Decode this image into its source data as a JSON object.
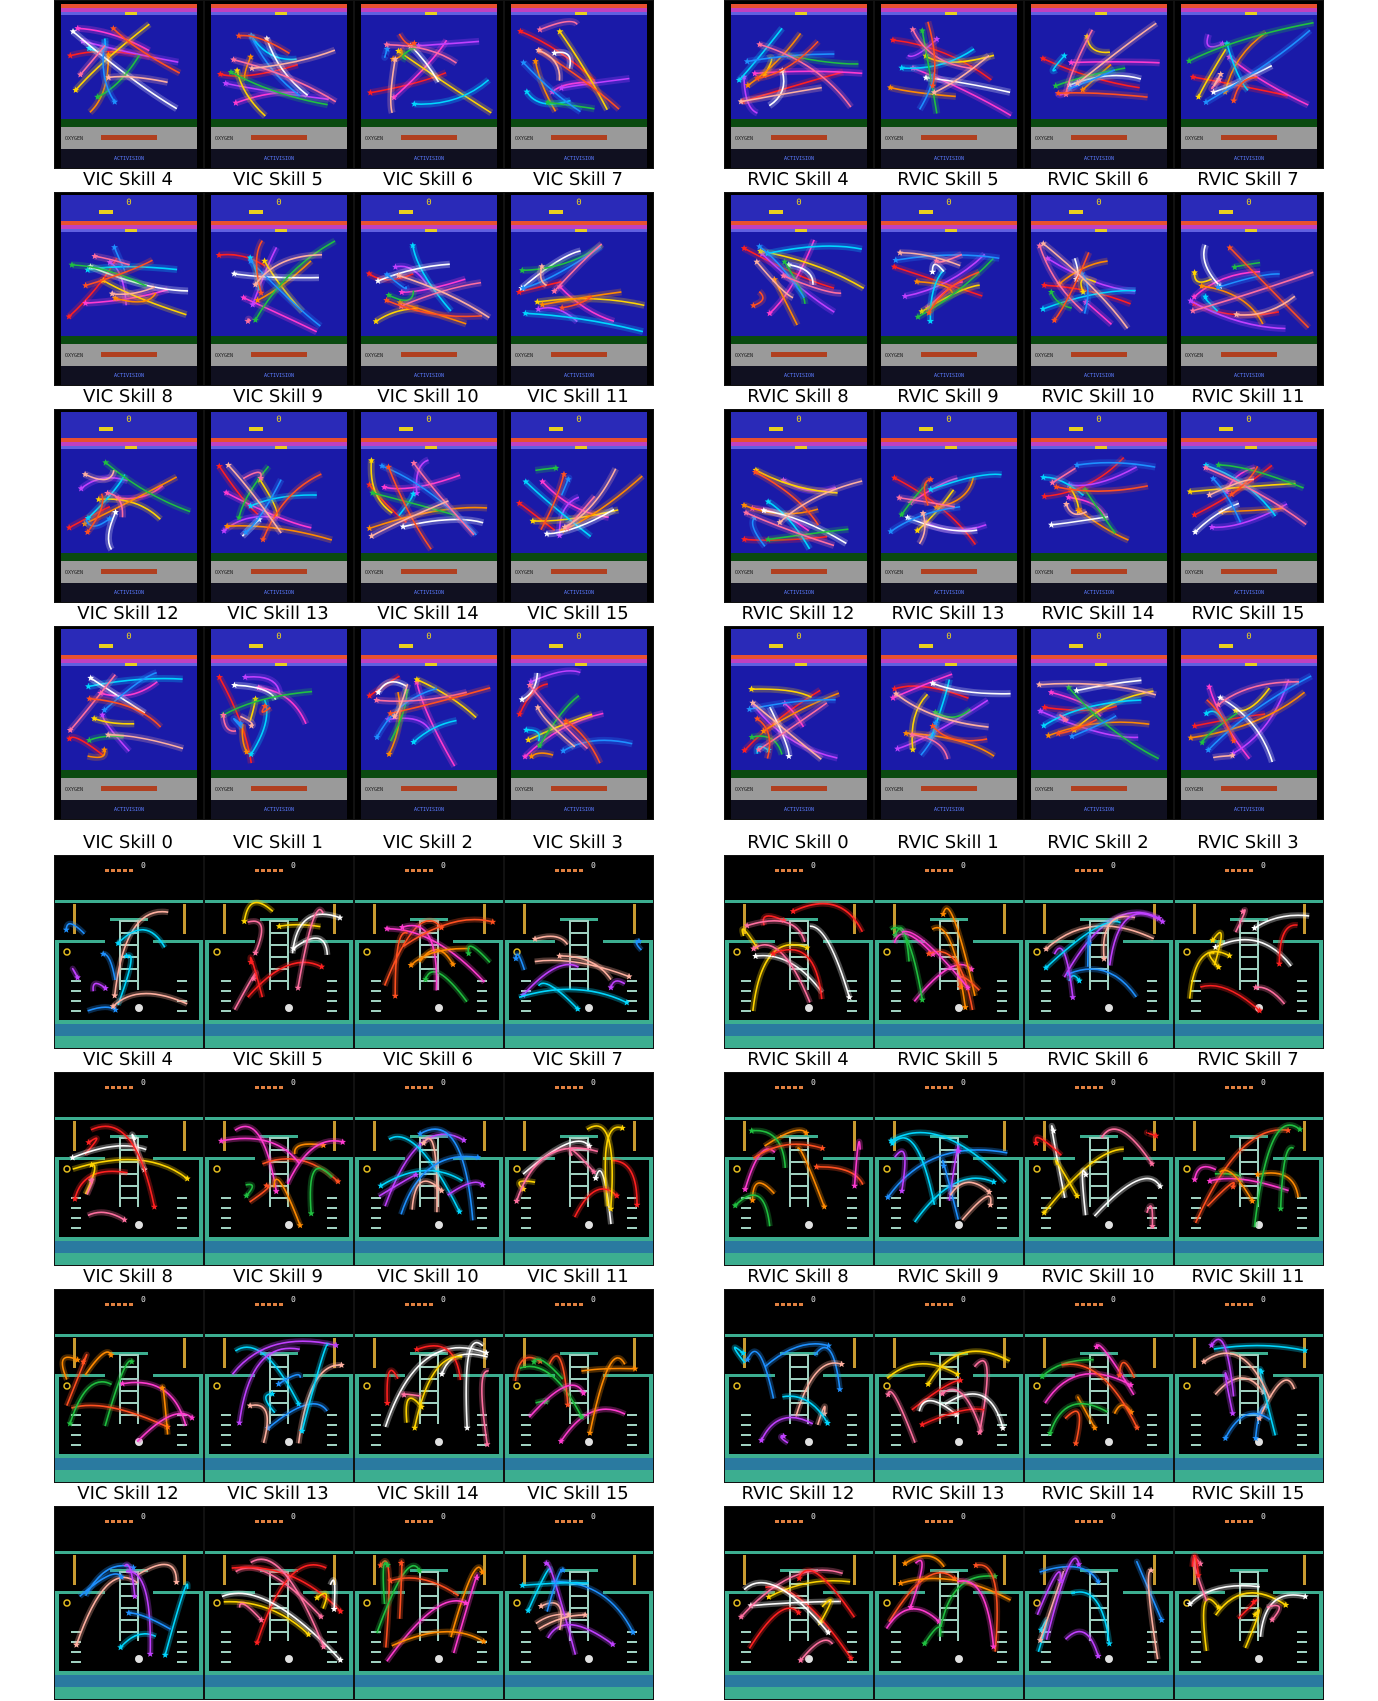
{
  "groups": [
    {
      "id": "seaquest-vic",
      "game": "seaquest",
      "prefix": "VIC",
      "labels": [
        "VIC Skill 4",
        "VIC Skill 5",
        "VIC Skill 6",
        "VIC Skill 7",
        "VIC Skill 8",
        "VIC Skill 9",
        "VIC Skill 10",
        "VIC Skill 11",
        "VIC Skill 12",
        "VIC Skill 13",
        "VIC Skill 14",
        "VIC Skill 15"
      ],
      "top_row_partial": true
    },
    {
      "id": "seaquest-rvic",
      "game": "seaquest",
      "prefix": "RVIC",
      "labels": [
        "RVIC Skill 4",
        "RVIC Skill 5",
        "RVIC Skill 6",
        "RVIC Skill 7",
        "RVIC Skill 8",
        "RVIC Skill 9",
        "RVIC Skill 10",
        "RVIC Skill 11",
        "RVIC Skill 12",
        "RVIC Skill 13",
        "RVIC Skill 14",
        "RVIC Skill 15"
      ],
      "top_row_partial": true
    },
    {
      "id": "montezuma-vic",
      "game": "montezuma",
      "prefix": "VIC",
      "labels": [
        "VIC Skill 0",
        "VIC Skill 1",
        "VIC Skill 2",
        "VIC Skill 3",
        "VIC Skill 4",
        "VIC Skill 5",
        "VIC Skill 6",
        "VIC Skill 7",
        "VIC Skill 8",
        "VIC Skill 9",
        "VIC Skill 10",
        "VIC Skill 11",
        "VIC Skill 12",
        "VIC Skill 13",
        "VIC Skill 14",
        "VIC Skill 15"
      ],
      "top_row_partial": false
    },
    {
      "id": "montezuma-rvic",
      "game": "montezuma",
      "prefix": "RVIC",
      "labels": [
        "RVIC Skill 0",
        "RVIC Skill 1",
        "RVIC Skill 2",
        "RVIC Skill 3",
        "RVIC Skill 4",
        "RVIC Skill 5",
        "RVIC Skill 6",
        "RVIC Skill 7",
        "RVIC Skill 8",
        "RVIC Skill 9",
        "RVIC Skill 10",
        "RVIC Skill 11",
        "RVIC Skill 12",
        "RVIC Skill 13",
        "RVIC Skill 14",
        "RVIC Skill 15"
      ],
      "top_row_partial": false
    }
  ],
  "seaquest_text": {
    "oxygen": "OXYGEN",
    "brand": "ACTIVISION",
    "score": "0"
  },
  "montezuma_text": {
    "score": "0"
  },
  "trajectory_colors": [
    "#ff2020",
    "#ff3bd0",
    "#c040ff",
    "#ffd400",
    "#ff8a00",
    "#00d7ff",
    "#ffffff",
    "#20c040",
    "#1e90ff",
    "#ff6fa0",
    "#ff5020",
    "#ffb0a0"
  ]
}
